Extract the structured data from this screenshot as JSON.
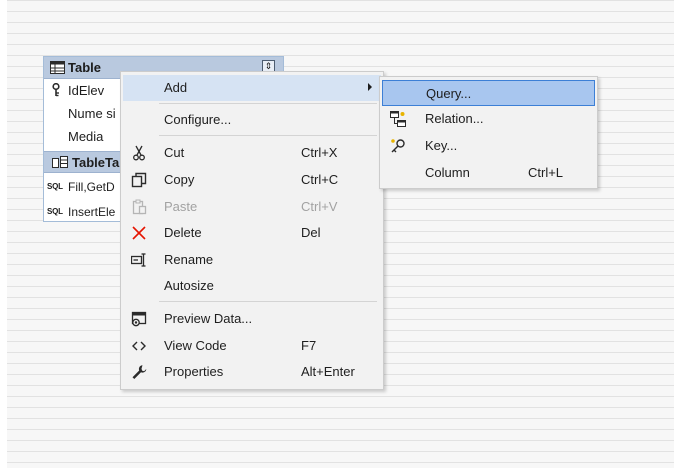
{
  "table_widget": {
    "title": "Table",
    "rows": [
      "IdElev",
      "Nume si",
      "Media"
    ],
    "adapter_title": "TableTa",
    "methods": [
      {
        "tag": "SQL",
        "label": "Fill,GetD"
      },
      {
        "tag": "SQL",
        "label": "InsertEle"
      }
    ]
  },
  "main_menu": {
    "items": [
      {
        "label": "Add",
        "shortcut": "",
        "icon": "none",
        "submenu": true,
        "highlighted": true
      },
      {
        "label": "Configure...",
        "shortcut": "",
        "icon": "none"
      },
      {
        "label": "Cut",
        "shortcut": "Ctrl+X",
        "icon": "scissors-icon"
      },
      {
        "label": "Copy",
        "shortcut": "Ctrl+C",
        "icon": "copy-icon"
      },
      {
        "label": "Paste",
        "shortcut": "Ctrl+V",
        "icon": "paste-icon",
        "disabled": true
      },
      {
        "label": "Delete",
        "shortcut": "Del",
        "icon": "delete-x-icon"
      },
      {
        "label": "Rename",
        "shortcut": "",
        "icon": "rename-icon"
      },
      {
        "label": "Autosize",
        "shortcut": "",
        "icon": "none"
      },
      {
        "label": "Preview Data...",
        "shortcut": "",
        "icon": "preview-data-icon"
      },
      {
        "label": "View Code",
        "shortcut": "F7",
        "icon": "code-brackets-icon"
      },
      {
        "label": "Properties",
        "shortcut": "Alt+Enter",
        "icon": "wrench-icon"
      }
    ]
  },
  "sub_menu": {
    "items": [
      {
        "label": "Query...",
        "shortcut": "",
        "icon": "none",
        "selected": true
      },
      {
        "label": "Relation...",
        "shortcut": "",
        "icon": "relation-icon"
      },
      {
        "label": "Key...",
        "shortcut": "",
        "icon": "key-icon"
      },
      {
        "label": "Column",
        "shortcut": "Ctrl+L",
        "icon": "none"
      }
    ]
  },
  "colors": {
    "menu_bg": "#f2f2f2",
    "hover": "#d6e3f3",
    "selected": "#a8c6ef",
    "selected_border": "#3c7fd6",
    "header_blue": "#b9c9df",
    "delete_red": "#e51400"
  }
}
